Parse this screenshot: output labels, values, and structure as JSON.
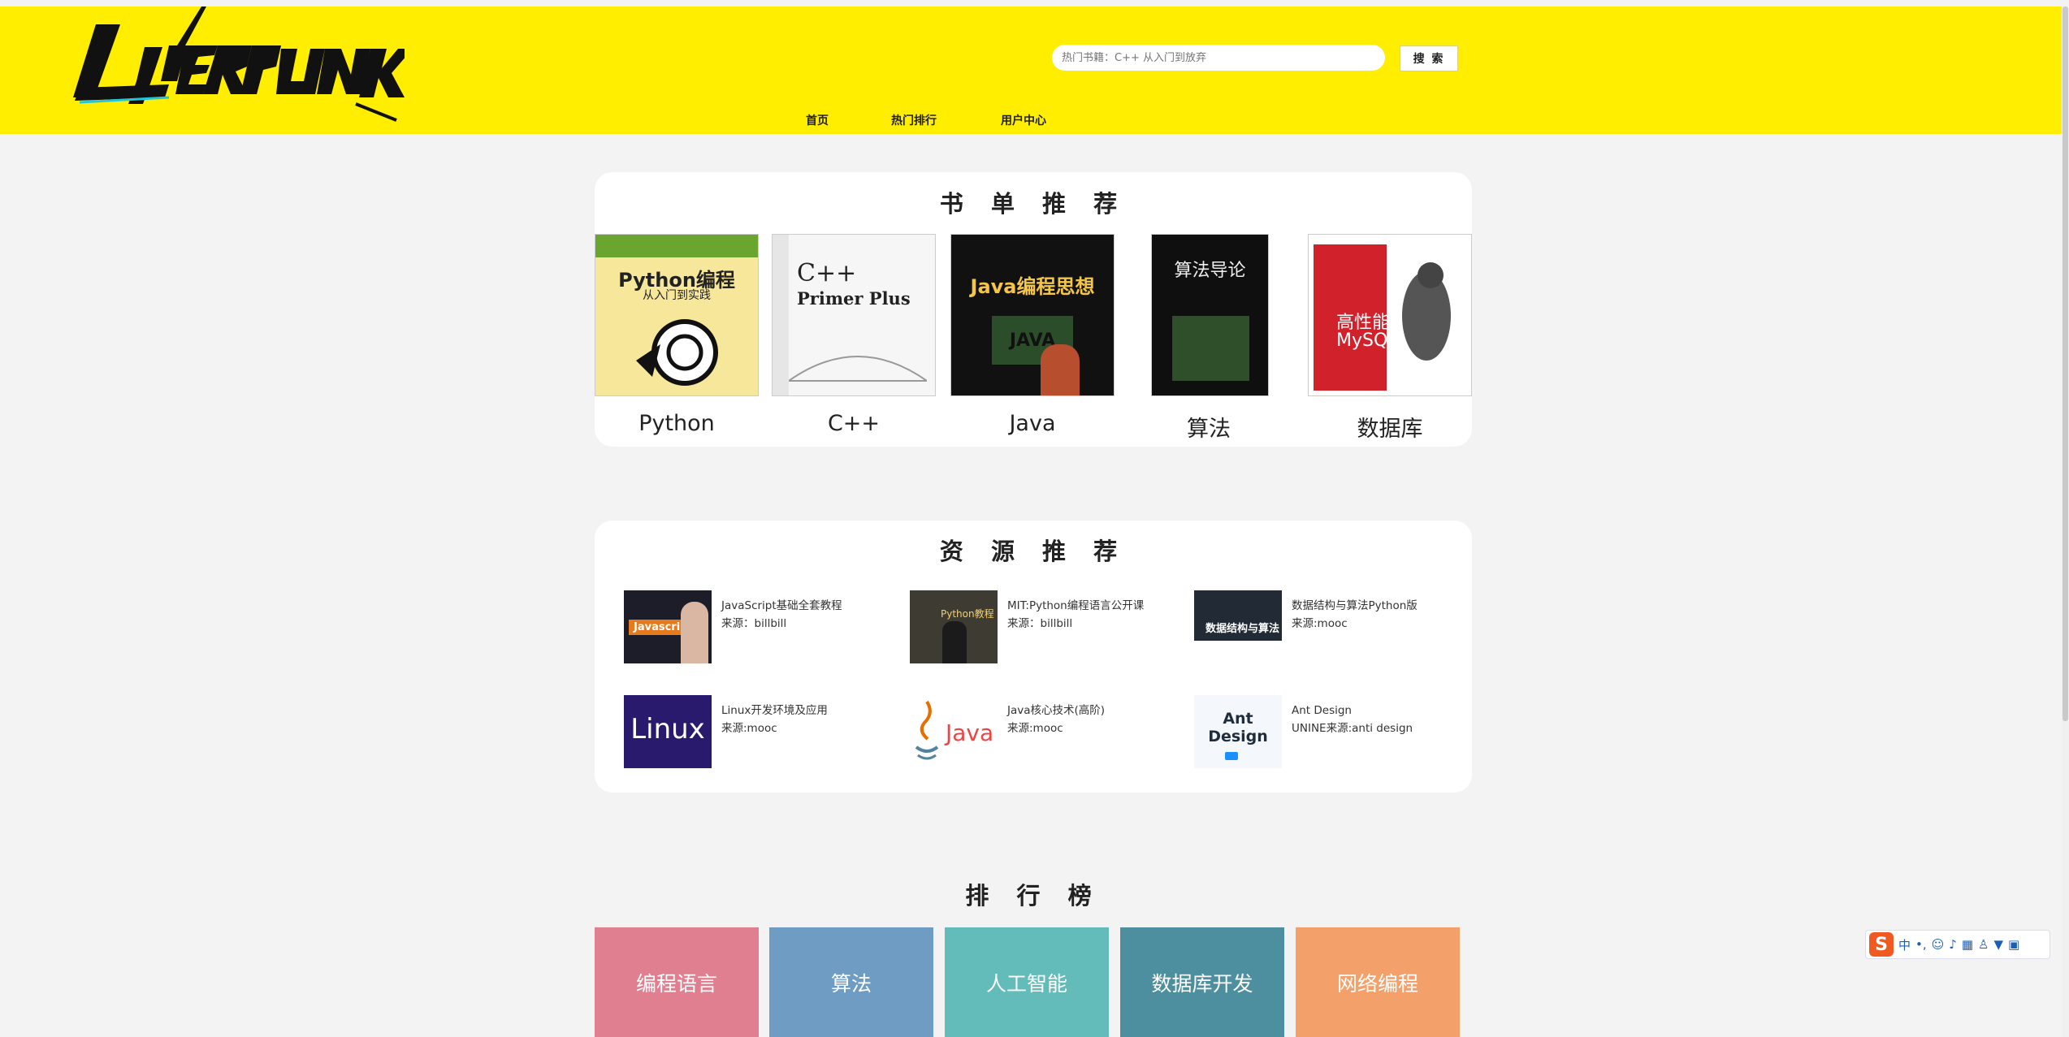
{
  "header": {
    "logo_text": "CYBERPUNK",
    "search_placeholder": "热门书籍：C++ 从入门到放弃",
    "search_button": "搜 索",
    "nav": [
      "首页",
      "热门排行",
      "用户中心"
    ]
  },
  "books": {
    "title": "书 单 推 荐",
    "items": [
      {
        "label": "Python",
        "cover_title": "Python编程",
        "cover_sub": "从入门到实践"
      },
      {
        "label": "C++",
        "cover_title": "C++",
        "cover_sub": "Primer Plus"
      },
      {
        "label": "Java",
        "cover_title": "Java编程思想",
        "cover_sub": "JAVA"
      },
      {
        "label": "算法",
        "cover_title": "算法导论",
        "cover_sub": ""
      },
      {
        "label": "数据库",
        "cover_title": "高性能",
        "cover_sub": "MySQL"
      }
    ]
  },
  "resources": {
    "title": "资 源 推 荐",
    "items": [
      {
        "name": "JavaScript基础全套教程",
        "source": "来源：billbill",
        "thumb_text": "Javascript"
      },
      {
        "name": "MIT:Python编程语言公开课",
        "source": "来源：billbill",
        "thumb_text": "Python教程"
      },
      {
        "name": "数据结构与算法Python版",
        "source": "来源:mooc",
        "thumb_text": "数据结构与算法"
      },
      {
        "name": "Linux开发环境及应用",
        "source": "来源:mooc",
        "thumb_text": "Linux"
      },
      {
        "name": "Java核心技术(高阶)",
        "source": "来源:mooc",
        "thumb_text": "Java"
      },
      {
        "name": "Ant Design",
        "source": "UNINE来源:anti design",
        "thumb_text": "Ant Design"
      }
    ]
  },
  "ranking": {
    "title": "排 行 榜",
    "tiles": [
      {
        "label": "编程语言",
        "color": "#e07f8f"
      },
      {
        "label": "算法",
        "color": "#6f9cc2"
      },
      {
        "label": "人工智能",
        "color": "#63bcb9"
      },
      {
        "label": "数据库开发",
        "color": "#4d8f9e"
      },
      {
        "label": "网络编程",
        "color": "#f4a06a"
      }
    ]
  },
  "ime": {
    "badge": "S",
    "lang": "中"
  }
}
